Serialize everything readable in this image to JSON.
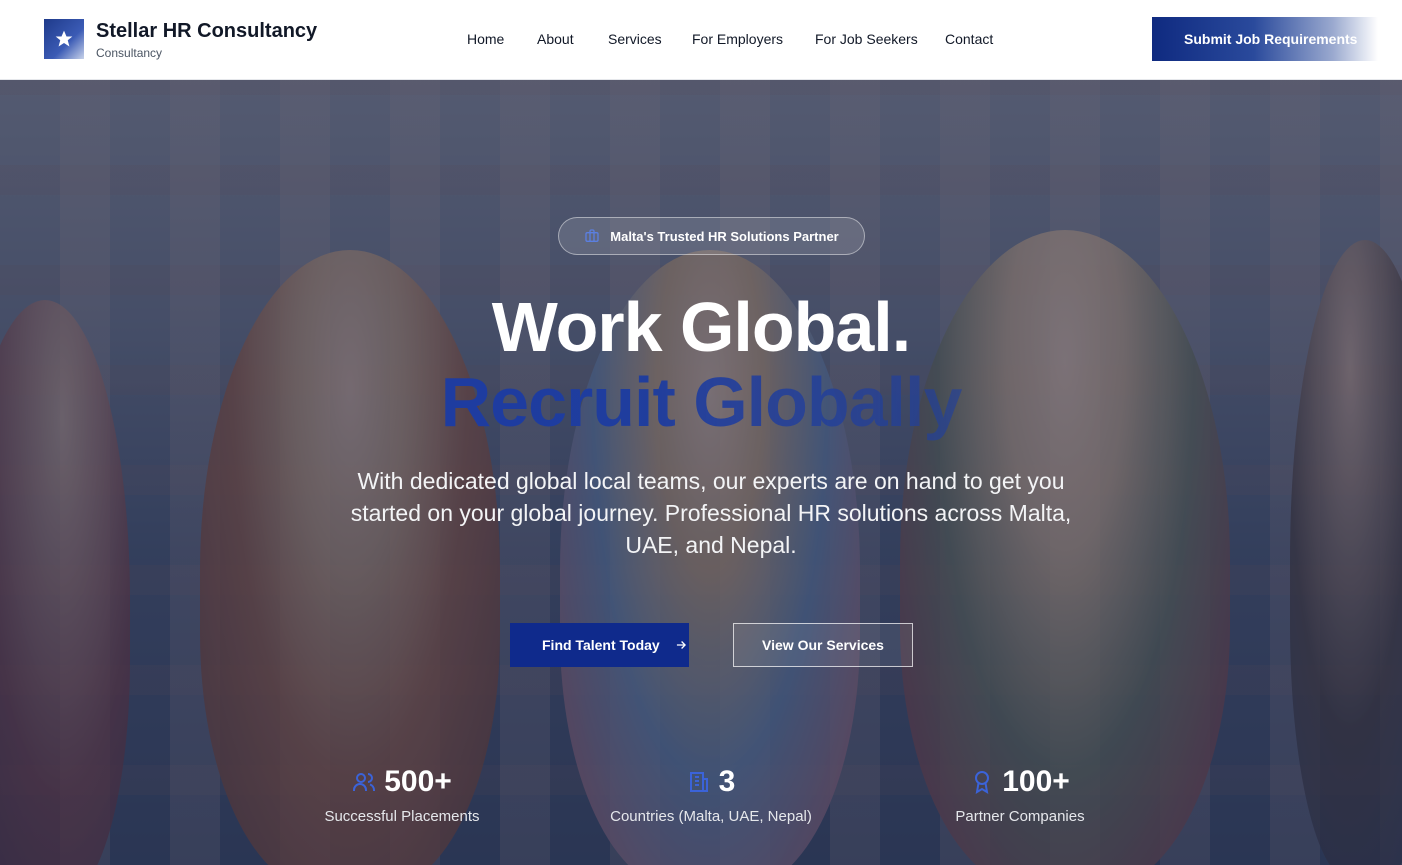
{
  "brand": {
    "title": "Stellar HR Consultancy",
    "subtitle": "Consultancy",
    "logo_icon": "star-icon"
  },
  "nav": {
    "items": [
      {
        "label": "Home"
      },
      {
        "label": "About"
      },
      {
        "label": "Services"
      },
      {
        "label": "For Employers"
      },
      {
        "label": "For Job Seekers"
      },
      {
        "label": "Contact"
      }
    ],
    "cta_label": "Submit Job Requirements"
  },
  "hero": {
    "badge_icon": "briefcase-icon",
    "badge_text": "Malta's Trusted HR Solutions Partner",
    "headline_line1": "Work Global.",
    "headline_line2": "Recruit Globally",
    "lead": "With dedicated global local teams, our experts are on hand to get you started on your global journey. Professional HR solutions across Malta, UAE, and Nepal.",
    "primary_button": "Find Talent Today",
    "secondary_button": "View Our Services"
  },
  "stats": [
    {
      "icon": "users-icon",
      "value": "500+",
      "label": "Successful Placements"
    },
    {
      "icon": "building-icon",
      "value": "3",
      "label": "Countries (Malta, UAE, Nepal)"
    },
    {
      "icon": "award-icon",
      "value": "100+",
      "label": "Partner Companies"
    }
  ],
  "colors": {
    "brand_navy": "#0f2a8c",
    "accent_blue": "#1e40af",
    "text_dark": "#111827"
  }
}
